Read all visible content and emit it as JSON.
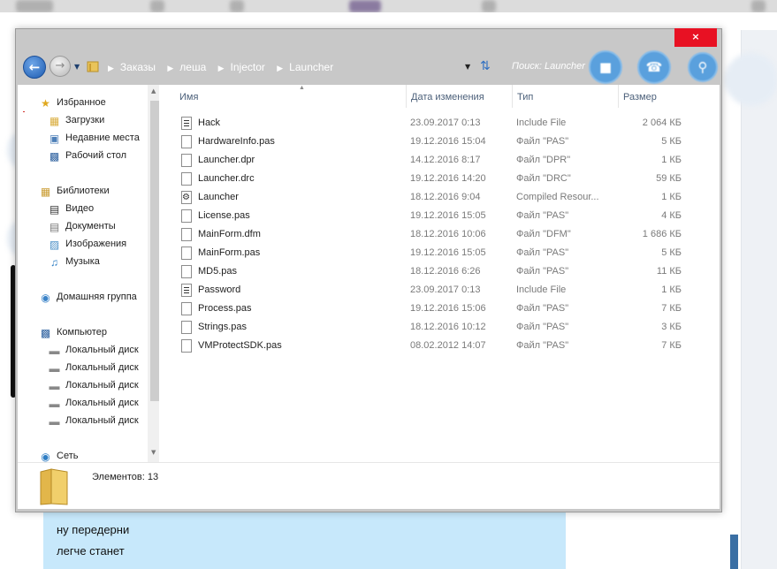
{
  "window": {
    "close_label": "×",
    "breadcrumbs": [
      "Заказы",
      "леша",
      "Injector",
      "Launcher"
    ],
    "search_placeholder": "Поиск: Launcher"
  },
  "nav_pane": {
    "items": [
      {
        "label": "Избранное",
        "icon": "star-icon",
        "selected": true
      },
      {
        "label": "Загрузки",
        "icon": "downloads-folder-icon"
      },
      {
        "label": "Недавние места",
        "icon": "recent-places-icon"
      },
      {
        "label": "Рабочий стол",
        "icon": "desktop-icon"
      },
      {
        "label": "Библиотеки",
        "icon": "libraries-icon"
      },
      {
        "label": "Видео",
        "icon": "video-icon"
      },
      {
        "label": "Документы",
        "icon": "documents-icon"
      },
      {
        "label": "Изображения",
        "icon": "pictures-icon"
      },
      {
        "label": "Музыка",
        "icon": "music-icon"
      },
      {
        "label": "Домашняя группа",
        "icon": "homegroup-icon"
      },
      {
        "label": "Компьютер",
        "icon": "computer-icon"
      },
      {
        "label": "Локальный диск",
        "icon": "drive-icon"
      },
      {
        "label": "Локальный диск",
        "icon": "drive-icon"
      },
      {
        "label": "Локальный диск",
        "icon": "drive-icon"
      },
      {
        "label": "Локальный диск",
        "icon": "drive-icon"
      },
      {
        "label": "Локальный диск",
        "icon": "drive-icon"
      },
      {
        "label": "Сеть",
        "icon": "network-icon"
      }
    ]
  },
  "columns": {
    "name": "Имя",
    "date": "Дата изменения",
    "type": "Тип",
    "size": "Размер"
  },
  "files": [
    {
      "name": "Hack",
      "date": "23.09.2017 0:13",
      "type": "Include File",
      "size": "2 064 КБ",
      "icon": "text-file-icon"
    },
    {
      "name": "HardwareInfo.pas",
      "date": "19.12.2016 15:04",
      "type": "Файл \"PAS\"",
      "size": "5 КБ",
      "icon": "file-icon"
    },
    {
      "name": "Launcher.dpr",
      "date": "14.12.2016 8:17",
      "type": "Файл \"DPR\"",
      "size": "1 КБ",
      "icon": "file-icon"
    },
    {
      "name": "Launcher.drc",
      "date": "19.12.2016 14:20",
      "type": "Файл \"DRC\"",
      "size": "59 КБ",
      "icon": "file-icon"
    },
    {
      "name": "Launcher",
      "date": "18.12.2016 9:04",
      "type": "Compiled Resour...",
      "size": "1 КБ",
      "icon": "resource-file-icon"
    },
    {
      "name": "License.pas",
      "date": "19.12.2016 15:05",
      "type": "Файл \"PAS\"",
      "size": "4 КБ",
      "icon": "file-icon"
    },
    {
      "name": "MainForm.dfm",
      "date": "18.12.2016 10:06",
      "type": "Файл \"DFM\"",
      "size": "1 686 КБ",
      "icon": "file-icon"
    },
    {
      "name": "MainForm.pas",
      "date": "19.12.2016 15:05",
      "type": "Файл \"PAS\"",
      "size": "5 КБ",
      "icon": "file-icon"
    },
    {
      "name": "MD5.pas",
      "date": "18.12.2016 6:26",
      "type": "Файл \"PAS\"",
      "size": "11 КБ",
      "icon": "file-icon"
    },
    {
      "name": "Password",
      "date": "23.09.2017 0:13",
      "type": "Include File",
      "size": "1 КБ",
      "icon": "text-file-icon"
    },
    {
      "name": "Process.pas",
      "date": "19.12.2016 15:06",
      "type": "Файл \"PAS\"",
      "size": "7 КБ",
      "icon": "file-icon"
    },
    {
      "name": "Strings.pas",
      "date": "18.12.2016 10:12",
      "type": "Файл \"PAS\"",
      "size": "3 КБ",
      "icon": "file-icon"
    },
    {
      "name": "VMProtectSDK.pas",
      "date": "08.02.2012 14:07",
      "type": "Файл \"PAS\"",
      "size": "7 КБ",
      "icon": "file-icon"
    }
  ],
  "details": {
    "count_text": "Элементов: 13"
  },
  "chat": {
    "lines": [
      "ну передерни",
      "легче станет"
    ]
  },
  "colors": {
    "close_button": "#e81123",
    "chat_bubble": "#c7e8fb",
    "window_chrome": "#c8c8c8"
  }
}
